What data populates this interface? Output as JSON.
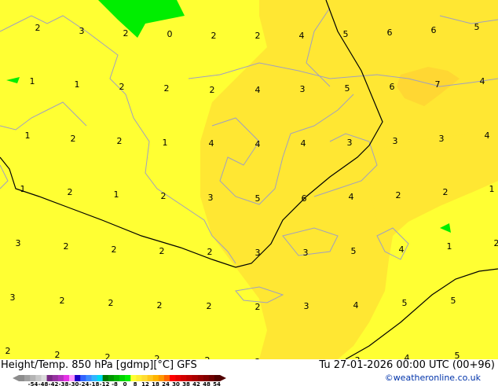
{
  "map": {
    "colors": {
      "base": "#ffff33",
      "mid": "#ffe733",
      "high": "#ffd733",
      "green": "#00ee00",
      "coast": "#a0a0c0",
      "contour": "#000000"
    },
    "labels": [
      "2",
      "3",
      "2",
      "0",
      "2",
      "2",
      "4",
      "5",
      "6",
      "6",
      "5",
      "1",
      "1",
      "2",
      "2",
      "2",
      "4",
      "3",
      "5",
      "6",
      "7",
      "4",
      "1",
      "2",
      "2",
      "1",
      "4",
      "4",
      "4",
      "3",
      "3",
      "3",
      "4",
      "1",
      "2",
      "1",
      "2",
      "3",
      "5",
      "6",
      "4",
      "2",
      "2",
      "1",
      "3",
      "2",
      "2",
      "2",
      "2",
      "3",
      "3",
      "5",
      "4",
      "1",
      "2",
      "3",
      "2",
      "2",
      "2",
      "2",
      "2",
      "3",
      "4",
      "5",
      "5",
      "2",
      "2",
      "2",
      "2",
      "2",
      "2",
      "3",
      "4",
      "5"
    ]
  },
  "footer": {
    "title": "Height/Temp. 850 hPa [gdmp][°C] GFS",
    "datetime": "Tu 27-01-2026 00:00 UTC (00+96)",
    "credit": "©weatheronline.co.uk"
  },
  "legend": {
    "ticks": [
      "-54",
      "-48",
      "-42",
      "-38",
      "-30",
      "-24",
      "-18",
      "-12",
      "-8",
      "0",
      "8",
      "12",
      "18",
      "24",
      "30",
      "38",
      "42",
      "48",
      "54"
    ],
    "colors": [
      "#8c8c8c",
      "#a0a0a0",
      "#b4b4b4",
      "#c8c8c8",
      "#dcdcdc",
      "#782882",
      "#9632a0",
      "#b432be",
      "#e632e6",
      "#ff96ff",
      "#1e00c8",
      "#3264ff",
      "#3c8cff",
      "#32b4ff",
      "#00dcf0",
      "#007800",
      "#009600",
      "#00b400",
      "#00d200",
      "#00f000",
      "#ffff33",
      "#ffee33",
      "#ffdc33",
      "#ffc81e",
      "#ffb400",
      "#ff9600",
      "#ff6400",
      "#ff0000",
      "#e60000",
      "#d20000",
      "#be0000",
      "#aa0000",
      "#960000",
      "#820000",
      "#6e0000",
      "#500000"
    ]
  }
}
